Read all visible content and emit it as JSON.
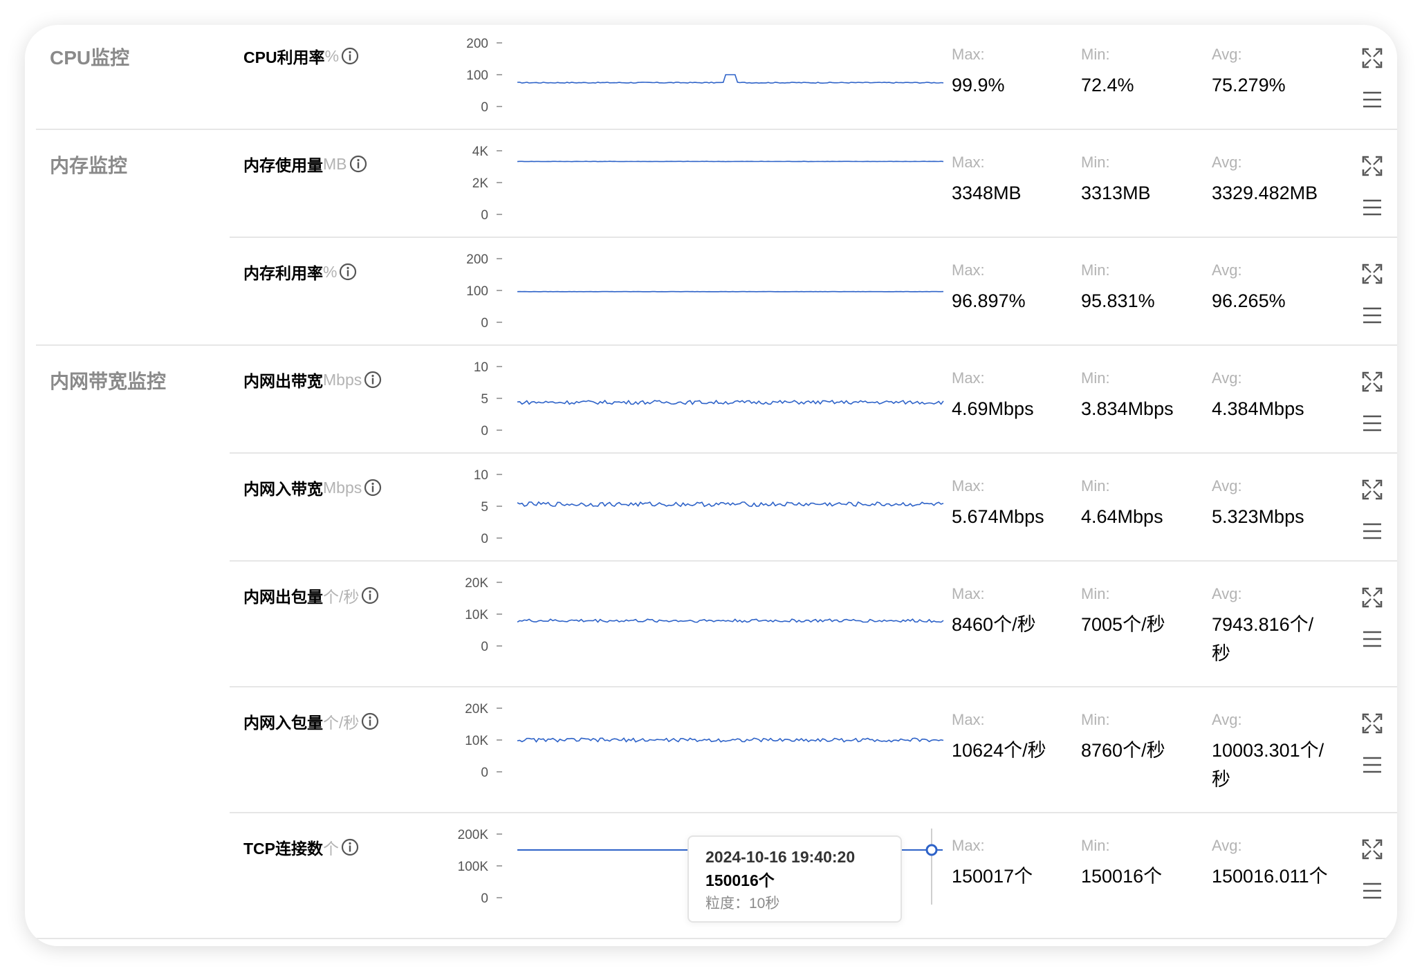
{
  "groups": [
    {
      "title": "CPU监控"
    },
    {
      "title": "内存监控"
    },
    {
      "title": "内网带宽监控"
    }
  ],
  "stat_labels": {
    "max": "Max:",
    "min": "Min:",
    "avg": "Avg:"
  },
  "metrics": [
    {
      "name": "CPU利用率",
      "unit": "%",
      "yticks": [
        "200",
        "100",
        "0"
      ],
      "max": "99.9%",
      "min": "72.4%",
      "avg": "75.279%"
    },
    {
      "name": "内存使用量",
      "unit": "MB",
      "yticks": [
        "4K",
        "2K",
        "0"
      ],
      "max": "3348MB",
      "min": "3313MB",
      "avg": "3329.482MB"
    },
    {
      "name": "内存利用率",
      "unit": "%",
      "yticks": [
        "200",
        "100",
        "0"
      ],
      "max": "96.897%",
      "min": "95.831%",
      "avg": "96.265%"
    },
    {
      "name": "内网出带宽",
      "unit": "Mbps",
      "yticks": [
        "10",
        "5",
        "0"
      ],
      "max": "4.69Mbps",
      "min": "3.834Mbps",
      "avg": "4.384Mbps"
    },
    {
      "name": "内网入带宽",
      "unit": "Mbps",
      "yticks": [
        "10",
        "5",
        "0"
      ],
      "max": "5.674Mbps",
      "min": "4.64Mbps",
      "avg": "5.323Mbps"
    },
    {
      "name": "内网出包量",
      "unit": "个/秒",
      "yticks": [
        "20K",
        "10K",
        "0"
      ],
      "max": "8460个/秒",
      "min": "7005个/秒",
      "avg": "7943.816个/秒"
    },
    {
      "name": "内网入包量",
      "unit": "个/秒",
      "yticks": [
        "20K",
        "10K",
        "0"
      ],
      "max": "10624个/秒",
      "min": "8760个/秒",
      "avg": "10003.301个/秒"
    },
    {
      "name": "TCP连接数",
      "unit": "个",
      "yticks": [
        "200K",
        "100K",
        "0"
      ],
      "max": "150017个",
      "min": "150016个",
      "avg": "150016.011个"
    }
  ],
  "chart_data": [
    {
      "type": "line",
      "series": [
        {
          "values": {
            "base": 75,
            "noise": 1.5,
            "spike_at": 0.5,
            "spike_to": 99.9
          }
        }
      ],
      "ylim": [
        0,
        200
      ]
    },
    {
      "type": "line",
      "series": [
        {
          "values": {
            "base": 3329,
            "noise": 10
          }
        }
      ],
      "ylim": [
        0,
        4000
      ]
    },
    {
      "type": "line",
      "series": [
        {
          "values": {
            "base": 96.3,
            "noise": 0.3
          }
        }
      ],
      "ylim": [
        0,
        200
      ]
    },
    {
      "type": "line",
      "series": [
        {
          "values": {
            "base": 4.38,
            "noise": 0.3
          }
        }
      ],
      "ylim": [
        0,
        10
      ]
    },
    {
      "type": "line",
      "series": [
        {
          "values": {
            "base": 5.32,
            "noise": 0.35
          }
        }
      ],
      "ylim": [
        0,
        10
      ]
    },
    {
      "type": "line",
      "series": [
        {
          "values": {
            "base": 7944,
            "noise": 500
          }
        }
      ],
      "ylim": [
        0,
        20000
      ]
    },
    {
      "type": "line",
      "series": [
        {
          "values": {
            "base": 10003,
            "noise": 600
          }
        }
      ],
      "ylim": [
        0,
        20000
      ]
    },
    {
      "type": "line",
      "series": [
        {
          "values": {
            "base": 150016,
            "noise": 0
          }
        }
      ],
      "ylim": [
        0,
        200000
      ]
    }
  ],
  "tooltip": {
    "time": "2024-10-16 19:40:20",
    "value": "150016个",
    "granularity": "粒度：10秒"
  },
  "colors": {
    "line": "#2d62c8",
    "tick": "#555555"
  },
  "icons": {
    "info": "info-icon",
    "expand": "expand-icon",
    "menu": "menu-icon"
  }
}
